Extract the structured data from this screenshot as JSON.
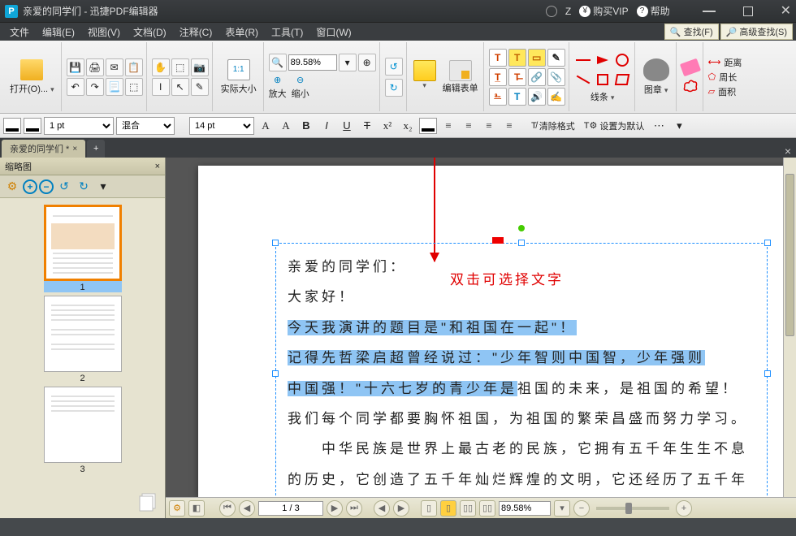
{
  "titlebar": {
    "title": "亲爱的同学们 - 迅捷PDF编辑器",
    "user": "Z",
    "vip": "购买VIP",
    "help": "帮助"
  },
  "menubar": {
    "items": [
      "文件",
      "编辑(E)",
      "视图(V)",
      "文档(D)",
      "注释(C)",
      "表单(R)",
      "工具(T)",
      "窗口(W)"
    ],
    "find": "查找(F)",
    "adv_find": "高级查找(S)"
  },
  "ribbon": {
    "open": "打开(O)...",
    "actual_size": "实际大小",
    "zoom_in": "放大",
    "zoom_out": "缩小",
    "zoom_value": "89.58%",
    "edit_form": "编辑表单",
    "lines": "线条",
    "stamp": "图章",
    "distance": "距离",
    "perimeter": "周长",
    "area": "面积"
  },
  "formatbar": {
    "line_width": "1 pt",
    "blend": "混合",
    "font_size": "14 pt",
    "clear_format": "清除格式",
    "set_default": "设置为默认"
  },
  "tabs": {
    "active": "亲爱的同学们 *"
  },
  "sidebar": {
    "title": "缩略图",
    "thumbs": [
      "1",
      "2",
      "3"
    ]
  },
  "document": {
    "line1": "亲爱的同学们：",
    "line2": "大家好！",
    "line3_sel": "今天我演讲的题目是\"和祖国在一起\"！",
    "line4_sel": "记得先哲梁启超曾经说过：\"少年智则中国智，少年强则",
    "line5_sel": "中国强！\"十六七岁的青少年是",
    "line5_rest": "祖国的未来，是祖国的希望！",
    "line6": "我们每个同学都要胸怀祖国，为祖国的繁荣昌盛而努力学习。",
    "line7": "　　中华民族是世界上最古老的民族，它拥有五千年生生不息",
    "line8": "的历史，它创造了五千年灿烂辉煌的文明，它还经历了五千年"
  },
  "annotation": {
    "text": "双击可选择文字"
  },
  "statusbar": {
    "page": "1 / 3",
    "zoom": "89.58%"
  }
}
